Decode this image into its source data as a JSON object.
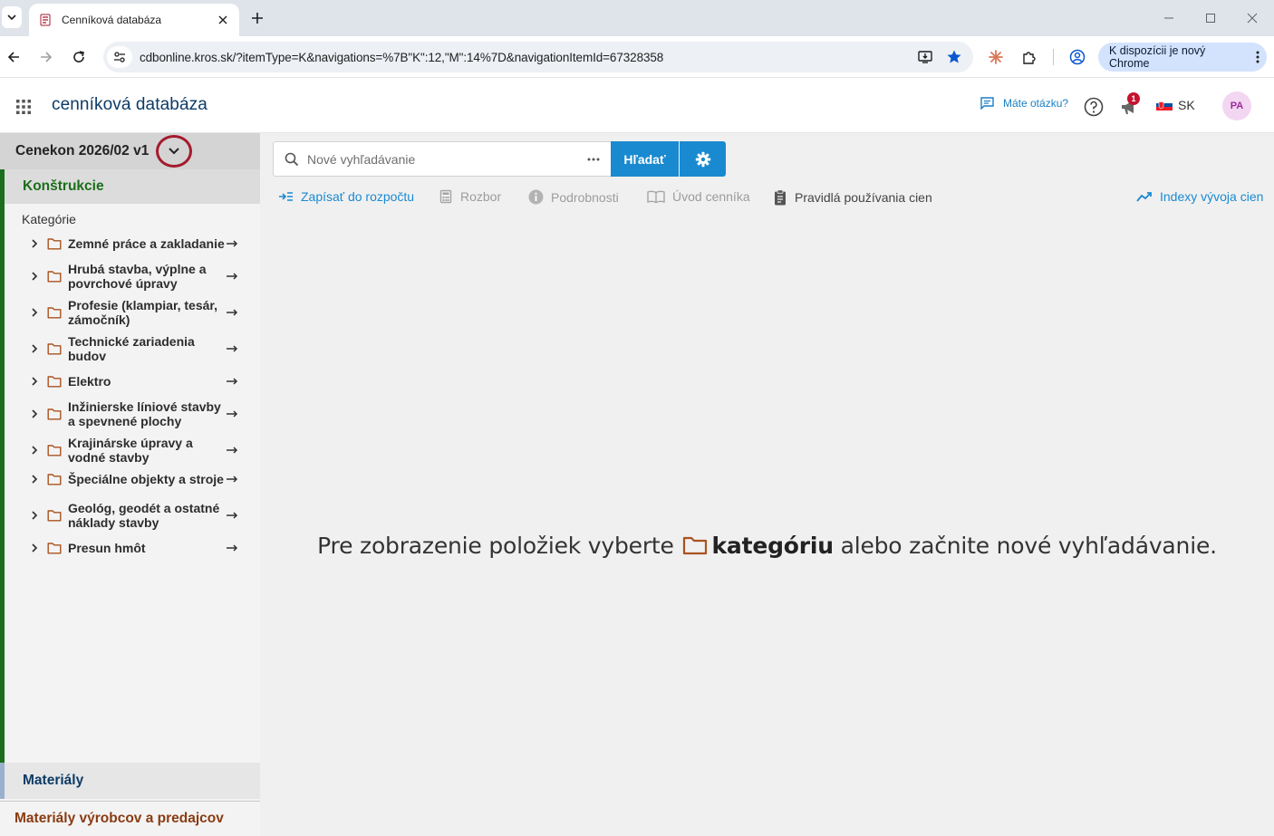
{
  "browser": {
    "tab_title": "Cenníková databáza",
    "url": "cdbonline.kros.sk/?itemType=K&navigations=%7B\"K\":12,\"M\":14%7D&navigationItemId=67328358",
    "update_label": "K dispozícii je nový Chrome"
  },
  "header": {
    "app_title": "cenníková databáza",
    "help_label": "Máte otázku?",
    "notification_count": "1",
    "language": "SK",
    "avatar_initials": "PA"
  },
  "sidebar": {
    "pricelist_name": "Cenekon 2026/02 v1",
    "section_konstrukcie": "Konštrukcie",
    "categories_heading": "Kategórie",
    "categories": [
      {
        "label": "Zemné práce a zakladanie"
      },
      {
        "label": "Hrubá stavba, výplne a povrchové úpravy"
      },
      {
        "label": "Profesie (klampiar, tesár, zámočník)"
      },
      {
        "label": "Technické zariadenia budov"
      },
      {
        "label": "Elektro"
      },
      {
        "label": "Inžinierske líniové stavby a spevnené plochy"
      },
      {
        "label": "Krajinárske úpravy a vodné stavby"
      },
      {
        "label": "Špeciálne objekty a stroje"
      },
      {
        "label": "Geológ, geodét a ostatné náklady stavby"
      },
      {
        "label": "Presun hmôt"
      }
    ],
    "section_materialy": "Materiály",
    "section_vyrobcov": "Materiály výrobcov a predajcov"
  },
  "search": {
    "placeholder": "Nové vyhľadávanie",
    "button_label": "Hľadať"
  },
  "actions": {
    "write_to_budget": "Zapísať do rozpočtu",
    "analysis": "Rozbor",
    "details": "Podrobnosti",
    "intro": "Úvod cenníka",
    "rules": "Pravidlá používania cien",
    "indexes": "Indexy vývoja cien"
  },
  "empty_state": {
    "before": "Pre zobrazenie položiek vyberte",
    "highlight": "kategóriu",
    "after": "alebo začnite nové vyhľadávanie."
  },
  "colors": {
    "accent": "#1a8ad0",
    "brand": "#0d3b66",
    "construction_green": "#1b6e1b",
    "folder_brown": "#a9521f",
    "materials_brown": "#8a3b12"
  }
}
